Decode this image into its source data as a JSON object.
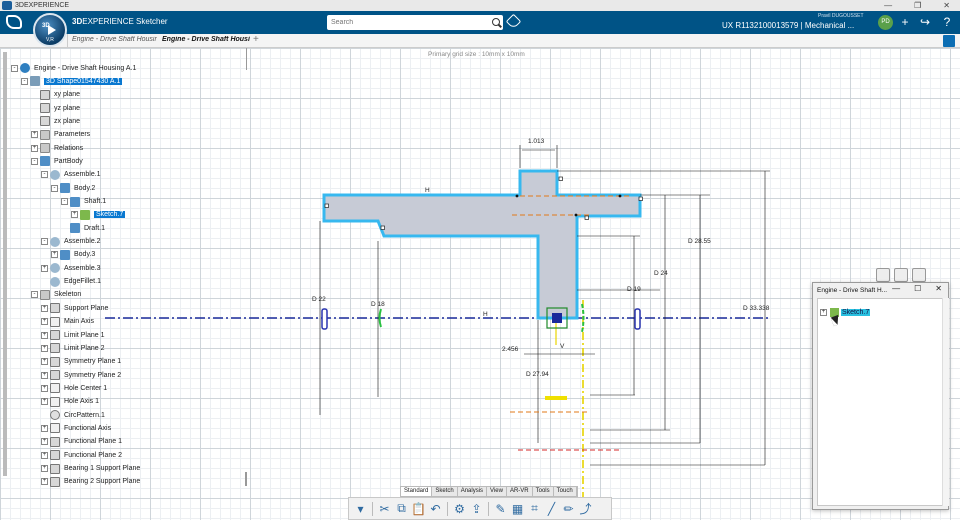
{
  "os_bar": {
    "title": "3DEXPERIENCE"
  },
  "header": {
    "app_prefix": "3D",
    "app_name": "EXPERIENCE Sketcher",
    "search_placeholder": "Search",
    "user": "Pravil DUGOUSSET",
    "context": "UX R1132100013579 | Mechanical ...",
    "avatar_initials": "PD",
    "compass_top": "3D",
    "compass_bottom": "V,R",
    "accent": "#005386"
  },
  "tabs": [
    {
      "label": "Engine - Drive Shaft Housing",
      "active": false
    },
    {
      "label": "Engine - Drive Shaft Housing",
      "active": true
    }
  ],
  "canvas": {
    "grid_label": "Primary grid size : 10mm x 10mm"
  },
  "tree": [
    {
      "label": "Engine - Drive Shaft Housing A.1",
      "level": 0,
      "icon": "product-icon",
      "toggle": "-"
    },
    {
      "label": "3D Shape01547430 A.1",
      "level": 1,
      "icon": "shape-icon",
      "toggle": "-",
      "selected": true
    },
    {
      "label": "xy plane",
      "level": 2,
      "icon": "plane-icon",
      "toggle": ""
    },
    {
      "label": "yz plane",
      "level": 2,
      "icon": "plane-icon",
      "toggle": ""
    },
    {
      "label": "zx plane",
      "level": 2,
      "icon": "plane-icon",
      "toggle": ""
    },
    {
      "label": "Parameters",
      "level": 2,
      "icon": "parameters-icon",
      "toggle": "+"
    },
    {
      "label": "Relations",
      "level": 2,
      "icon": "relations-icon",
      "toggle": "+"
    },
    {
      "label": "PartBody",
      "level": 2,
      "icon": "body-icon",
      "toggle": "-"
    },
    {
      "label": "Assemble.1",
      "level": 3,
      "icon": "assemble-icon",
      "toggle": "-"
    },
    {
      "label": "Body.2",
      "level": 4,
      "icon": "body-icon",
      "toggle": "-"
    },
    {
      "label": "Shaft.1",
      "level": 5,
      "icon": "shaft-icon",
      "toggle": "-"
    },
    {
      "label": "Sketch.7",
      "level": 6,
      "icon": "sketch-icon",
      "toggle": "+",
      "selected": true
    },
    {
      "label": "Draft.1",
      "level": 5,
      "icon": "draft-icon",
      "toggle": ""
    },
    {
      "label": "Assemble.2",
      "level": 3,
      "icon": "assemble-icon",
      "toggle": "-"
    },
    {
      "label": "Body.3",
      "level": 4,
      "icon": "body-icon",
      "toggle": "+"
    },
    {
      "label": "Assemble.3",
      "level": 3,
      "icon": "assemble-icon",
      "toggle": "+"
    },
    {
      "label": "EdgeFillet.1",
      "level": 3,
      "icon": "fillet-icon",
      "toggle": ""
    },
    {
      "label": "Skeleton",
      "level": 2,
      "icon": "geometrical-set-icon",
      "toggle": "-"
    },
    {
      "label": "Support Plane",
      "level": 3,
      "icon": "plane-icon",
      "toggle": "+"
    },
    {
      "label": "Main Axis",
      "level": 3,
      "icon": "axis-icon",
      "toggle": "+"
    },
    {
      "label": "Limit Plane 1",
      "level": 3,
      "icon": "plane-icon",
      "toggle": "+"
    },
    {
      "label": "Limit Plane 2",
      "level": 3,
      "icon": "plane-icon",
      "toggle": "+"
    },
    {
      "label": "Symmetry Plane 1",
      "level": 3,
      "icon": "plane-icon",
      "toggle": "+"
    },
    {
      "label": "Symmetry Plane 2",
      "level": 3,
      "icon": "plane-icon",
      "toggle": "+"
    },
    {
      "label": "Hole Center 1",
      "level": 3,
      "icon": "axis-icon",
      "toggle": "+"
    },
    {
      "label": "Hole Axis 1",
      "level": 3,
      "icon": "line-icon",
      "toggle": "+"
    },
    {
      "label": "CircPattern.1",
      "level": 3,
      "icon": "pattern-icon",
      "toggle": ""
    },
    {
      "label": "Functional Axis",
      "level": 3,
      "icon": "axis-icon",
      "toggle": "+"
    },
    {
      "label": "Functional Plane 1",
      "level": 3,
      "icon": "plane-icon",
      "toggle": "+"
    },
    {
      "label": "Functional Plane 2",
      "level": 3,
      "icon": "plane-icon",
      "toggle": "+"
    },
    {
      "label": "Bearing 1 Support Plane",
      "level": 3,
      "icon": "plane-icon",
      "toggle": "+"
    },
    {
      "label": "Bearing 2 Support Plane",
      "level": 3,
      "icon": "plane-icon",
      "toggle": "+"
    }
  ],
  "dimensions": {
    "d1": "1.013",
    "d2": "D 28.55",
    "d3": "D 24",
    "d4": "D 22",
    "d5": "D 18",
    "d6": "D 19",
    "d7": "D 33.338",
    "d8": "2.456",
    "d9": "D 27.94",
    "h1": "H",
    "h2": "H",
    "v1": "V"
  },
  "toolbar": {
    "tabs": [
      "Standard",
      "Sketch",
      "Analysis",
      "View",
      "AR-VR",
      "Tools",
      "Touch"
    ],
    "active_tab": "Standard"
  },
  "float_window": {
    "title": "Engine - Drive Shaft H...",
    "node_label": "Sketch.7"
  }
}
